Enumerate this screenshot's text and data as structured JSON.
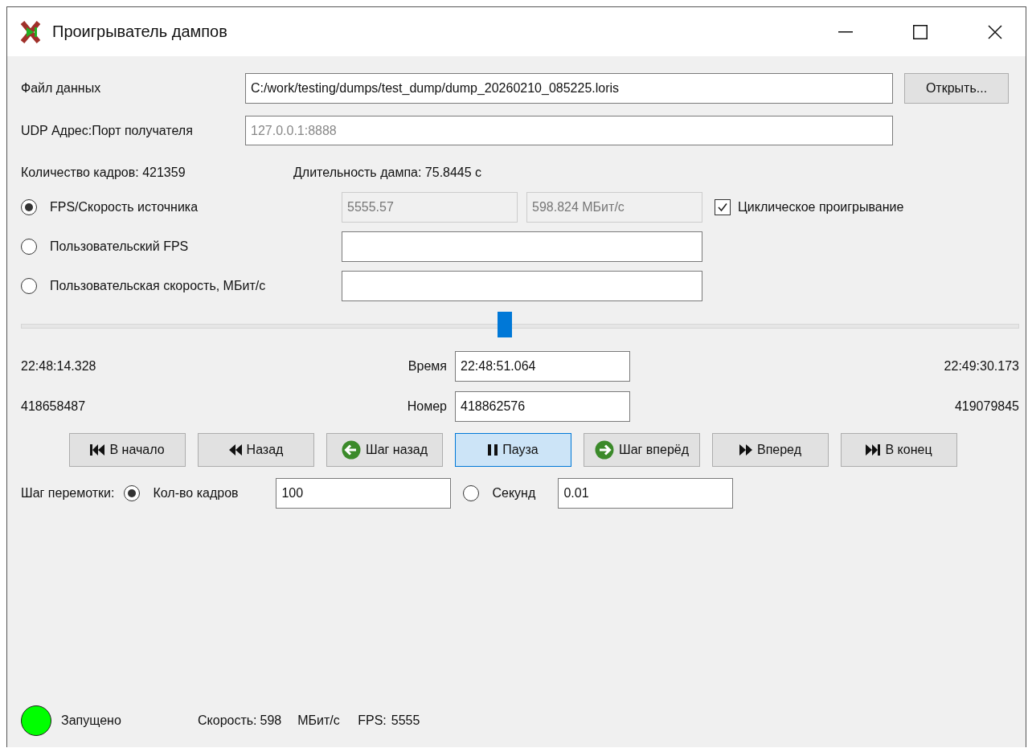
{
  "window": {
    "title": "Проигрыватель дампов"
  },
  "file": {
    "label": "Файл данных",
    "value": "C:/work/testing/dumps/test_dump/dump_20260210_085225.loris",
    "button": "Открыть..."
  },
  "udp": {
    "label": "UDP Адрес:Порт получателя",
    "placeholder": "127.0.0.1:8888"
  },
  "info": [
    "Количество кадров: 421359",
    "Длительность дампа: 75.8445 с"
  ],
  "rate_modes": [
    {
      "label": "FPS/Скорость источника",
      "selected": true,
      "fields": [
        {
          "value": "5555.57",
          "disabled": true
        },
        {
          "value": "598.824 МБит/с",
          "disabled": true
        }
      ]
    },
    {
      "label": "Пользовательский FPS",
      "selected": false
    },
    {
      "label": "Пользовательская скорость, МБит/с",
      "selected": false
    }
  ],
  "loop": {
    "label": "Циклическое проигрывание",
    "checked": true
  },
  "slider": {
    "level": 0.485
  },
  "time": {
    "start": "22:48:14.328",
    "label": "Время",
    "value": "22:48:51.064",
    "end": "22:49:30.173"
  },
  "frame": {
    "start": "418658487",
    "label": "Номер",
    "value": "418862576",
    "end": "419079845"
  },
  "controls": [
    {
      "label": "В начало",
      "kind": "first",
      "selected": false
    },
    {
      "label": "Назад",
      "kind": "rewind",
      "selected": false
    },
    {
      "label": "Шаг назад",
      "kind": "step-back",
      "selected": false
    },
    {
      "label": "Пауза",
      "kind": "pause",
      "selected": true
    },
    {
      "label": "Шаг вперёд",
      "kind": "step-forward",
      "selected": false
    },
    {
      "label": "Вперед",
      "kind": "forward",
      "selected": false
    },
    {
      "label": "В конец",
      "kind": "last",
      "selected": false
    }
  ],
  "step": {
    "label": "Шаг перемотки:",
    "options": [
      {
        "label": "Кол-во кадров",
        "selected": true,
        "value": "100"
      },
      {
        "label": "Секунд",
        "selected": false,
        "value": "0.01"
      }
    ]
  },
  "status": {
    "state": "Запущено",
    "color": "#00ff00",
    "speed_label": "Скорость:",
    "speed": "598",
    "speed_unit": "МБит/с",
    "fps_label": "FPS:",
    "fps": "5555"
  }
}
